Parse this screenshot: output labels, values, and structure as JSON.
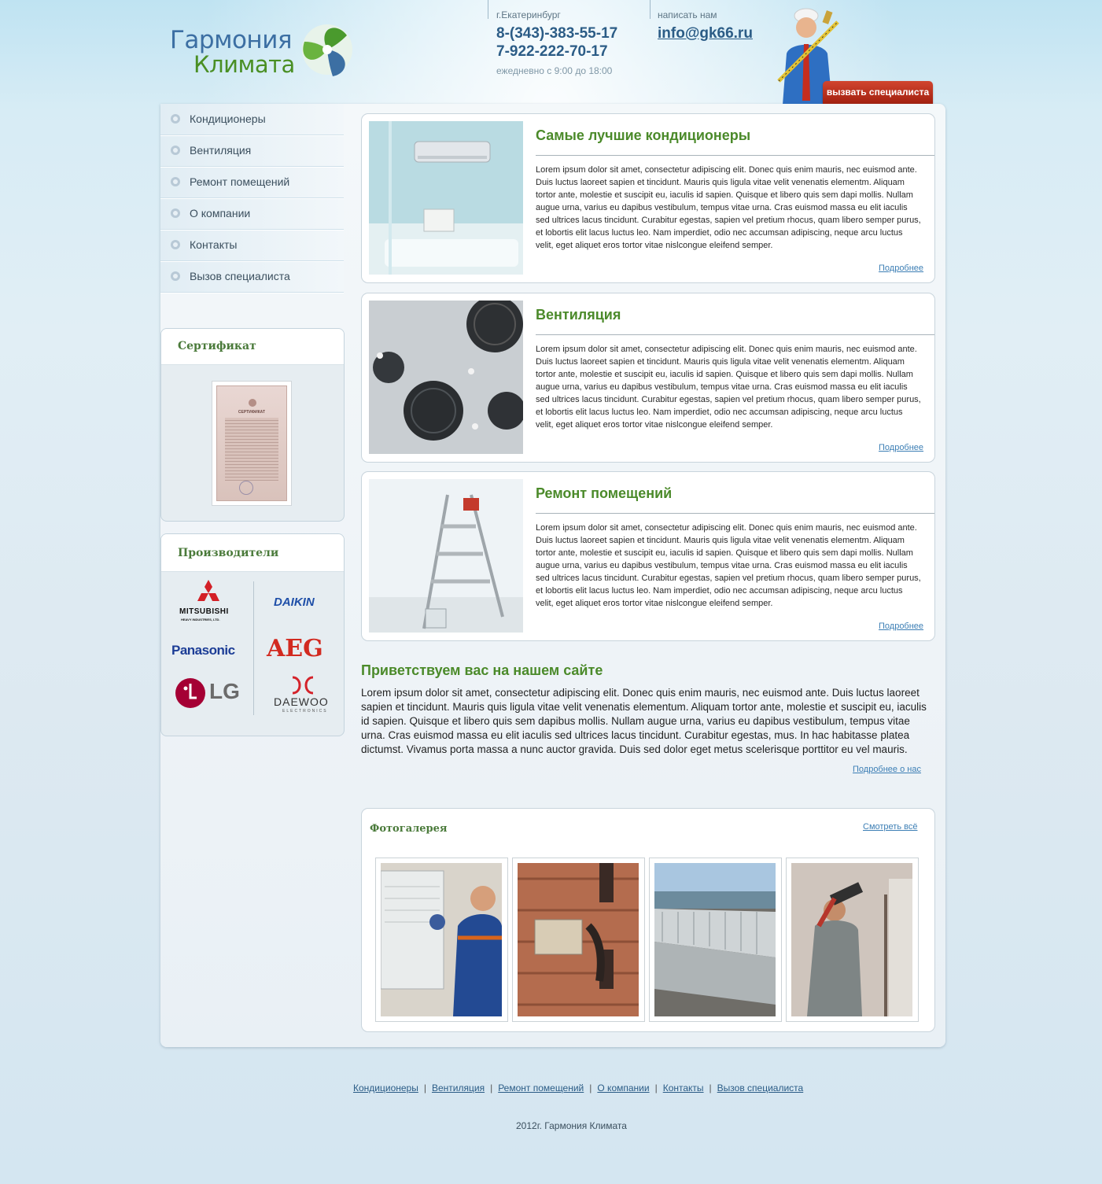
{
  "logo": {
    "line1": "Гармония",
    "line2": "Климата"
  },
  "contacts": {
    "city": "г.Екатеринбург",
    "phone1": "8-(343)-383-55-17",
    "phone2": "7-922-222-70-17",
    "hours": "ежедневно с 9:00 до 18:00",
    "write_label": "написать нам",
    "email": "info@gk66.ru"
  },
  "call_button": "вызвать специалиста",
  "sidebar": {
    "menu": [
      {
        "label": "Кондиционеры"
      },
      {
        "label": "Вентиляция"
      },
      {
        "label": "Ремонт помещений"
      },
      {
        "label": "О компании"
      },
      {
        "label": "Контакты"
      },
      {
        "label": "Вызов специалиста"
      }
    ],
    "certificate_title": "Сертификат",
    "certificate_image_text": "СЕРТИФИКАТ",
    "manufacturers_title": "Производители",
    "brands": {
      "mitsubishi": "MITSUBISHI",
      "mitsubishi_sub": "HEAVY INDUSTRIES, LTD.",
      "daikin": "DAIKIN",
      "panasonic": "Panasonic",
      "aeg": "AEG",
      "lg": "LG",
      "daewoo": "DAEWOO",
      "daewoo_sub": "ELECTRONICS"
    }
  },
  "cards": [
    {
      "title": "Самые лучшие кондиционеры",
      "text": "Lorem ipsum dolor sit amet, consectetur adipiscing elit. Donec quis enim mauris, nec euismod ante. Duis luctus laoreet sapien et tincidunt. Mauris quis ligula vitae velit venenatis elementm. Aliquam tortor ante, molestie et suscipit eu, iaculis id sapien. Quisque et libero quis sem dapi mollis. Nullam augue urna, varius eu dapibus vestibulum, tempus vitae urna. Cras euismod massa eu elit iaculis sed ultrices lacus tincidunt. Curabitur egestas, sapien vel pretium rhocus, quam libero semper purus, et lobortis elit lacus luctus leo. Nam imperdiet, odio nec accumsan adipiscing, neque arcu luctus velit, eget aliquet eros tortor vitae nislcongue eleifend semper.",
      "more": "Подробнее"
    },
    {
      "title": "Вентиляция",
      "text": "Lorem ipsum dolor sit amet, consectetur adipiscing elit. Donec quis enim mauris, nec euismod ante. Duis luctus laoreet sapien et tincidunt. Mauris quis ligula vitae velit venenatis elementm. Aliquam tortor ante, molestie et suscipit eu, iaculis id sapien. Quisque et libero quis sem dapi mollis. Nullam augue urna, varius eu dapibus vestibulum, tempus vitae urna. Cras euismod massa eu elit iaculis sed ultrices lacus tincidunt. Curabitur egestas, sapien vel pretium rhocus, quam libero semper purus, et lobortis elit lacus luctus leo. Nam imperdiet, odio nec accumsan adipiscing, neque arcu luctus velit, eget aliquet eros tortor vitae nislcongue eleifend semper.",
      "more": "Подробнее"
    },
    {
      "title": "Ремонт помещений",
      "text": "Lorem ipsum dolor sit amet, consectetur adipiscing elit. Donec quis enim mauris, nec euismod ante. Duis luctus laoreet sapien et tincidunt. Mauris quis ligula vitae velit venenatis elementm. Aliquam tortor ante, molestie et suscipit eu, iaculis id sapien. Quisque et libero quis sem dapi mollis. Nullam augue urna, varius eu dapibus vestibulum, tempus vitae urna. Cras euismod massa eu elit iaculis sed ultrices lacus tincidunt. Curabitur egestas, sapien vel pretium rhocus, quam libero semper purus, et lobortis elit lacus luctus leo. Nam imperdiet, odio nec accumsan adipiscing, neque arcu luctus velit, eget aliquet eros tortor vitae nislcongue eleifend semper.",
      "more": "Подробнее"
    }
  ],
  "welcome": {
    "title": "Приветствуем вас на нашем сайте",
    "text": "Lorem ipsum dolor sit amet, consectetur adipiscing elit. Donec quis enim mauris, nec euismod ante. Duis luctus laoreet sapien et tincidunt. Mauris quis ligula vitae velit venenatis elementum. Aliquam tortor ante, molestie et suscipit eu, iaculis id sapien. Quisque et libero quis sem dapibus mollis. Nullam augue urna, varius eu dapibus vestibulum, tempus vitae urna. Cras euismod massa eu elit iaculis sed ultrices lacus tincidunt. Curabitur egestas, mus. In hac habitasse platea dictumst. Vivamus porta massa a nunc auctor gravida. Duis sed dolor eget metus scelerisque porttitor eu vel mauris.",
    "more": "Подробнее о нас"
  },
  "gallery": {
    "title": "Фотогалерея",
    "view_all": "Смотреть всё"
  },
  "footer": {
    "links": [
      {
        "label": "Кондиционеры"
      },
      {
        "label": "Вентиляция"
      },
      {
        "label": "Ремонт помещений"
      },
      {
        "label": "О компании"
      },
      {
        "label": "Контакты"
      },
      {
        "label": "Вызов специалиста"
      }
    ],
    "separator": "|",
    "copyright": "2012г. Гармония Климата"
  },
  "colors": {
    "accent_green": "#4b8a2a",
    "link_blue": "#3d7fb5",
    "phone_blue": "#2b5c86",
    "call_button_red": "#b83219"
  }
}
